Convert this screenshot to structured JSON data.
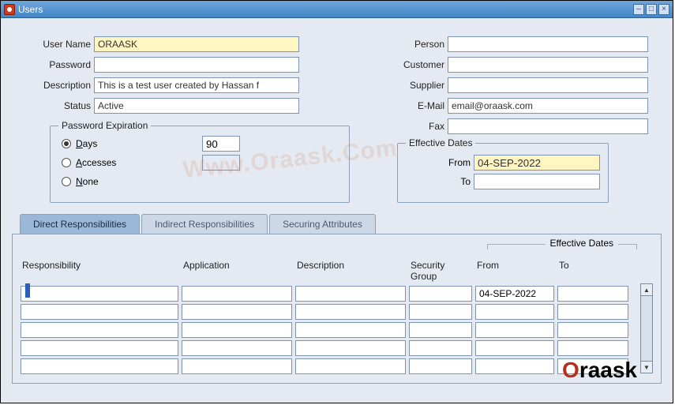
{
  "window": {
    "title": "Users"
  },
  "labels": {
    "userName": "User Name",
    "password": "Password",
    "description": "Description",
    "status": "Status",
    "person": "Person",
    "customer": "Customer",
    "supplier": "Supplier",
    "email": "E-Mail",
    "fax": "Fax"
  },
  "values": {
    "userName": "ORAASK",
    "password": "",
    "description": "This is a test user created by Hassan f",
    "status": "Active",
    "person": "",
    "customer": "",
    "supplier": "",
    "email": "email@oraask.com",
    "fax": ""
  },
  "passwordExpiration": {
    "legend": "Password Expiration",
    "days": {
      "label": "Days",
      "value": "90",
      "selected": true
    },
    "accesses": {
      "label": "Accesses",
      "value": "",
      "selected": false
    },
    "none": {
      "label": "None",
      "selected": false
    }
  },
  "effectiveDates": {
    "legend": "Effective Dates",
    "fromLabel": "From",
    "toLabel": "To",
    "from": "04-SEP-2022",
    "to": ""
  },
  "tabs": {
    "direct": "Direct Responsibilities",
    "indirect": "Indirect Responsibilities",
    "securing": "Securing Attributes"
  },
  "grid": {
    "effDatesLabel": "Effective Dates",
    "headers": {
      "responsibility": "Responsibility",
      "application": "Application",
      "description": "Description",
      "securityGroup": "Security Group",
      "from": "From",
      "to": "To"
    },
    "rows": [
      {
        "responsibility": "",
        "application": "",
        "description": "",
        "securityGroup": "",
        "from": "04-SEP-2022",
        "to": ""
      },
      {
        "responsibility": "",
        "application": "",
        "description": "",
        "securityGroup": "",
        "from": "",
        "to": ""
      },
      {
        "responsibility": "",
        "application": "",
        "description": "",
        "securityGroup": "",
        "from": "",
        "to": ""
      },
      {
        "responsibility": "",
        "application": "",
        "description": "",
        "securityGroup": "",
        "from": "",
        "to": ""
      },
      {
        "responsibility": "",
        "application": "",
        "description": "",
        "securityGroup": "",
        "from": "",
        "to": ""
      }
    ]
  },
  "watermark": "Www.Oraask.Com",
  "logo": {
    "accent": "O",
    "rest": "raask"
  }
}
